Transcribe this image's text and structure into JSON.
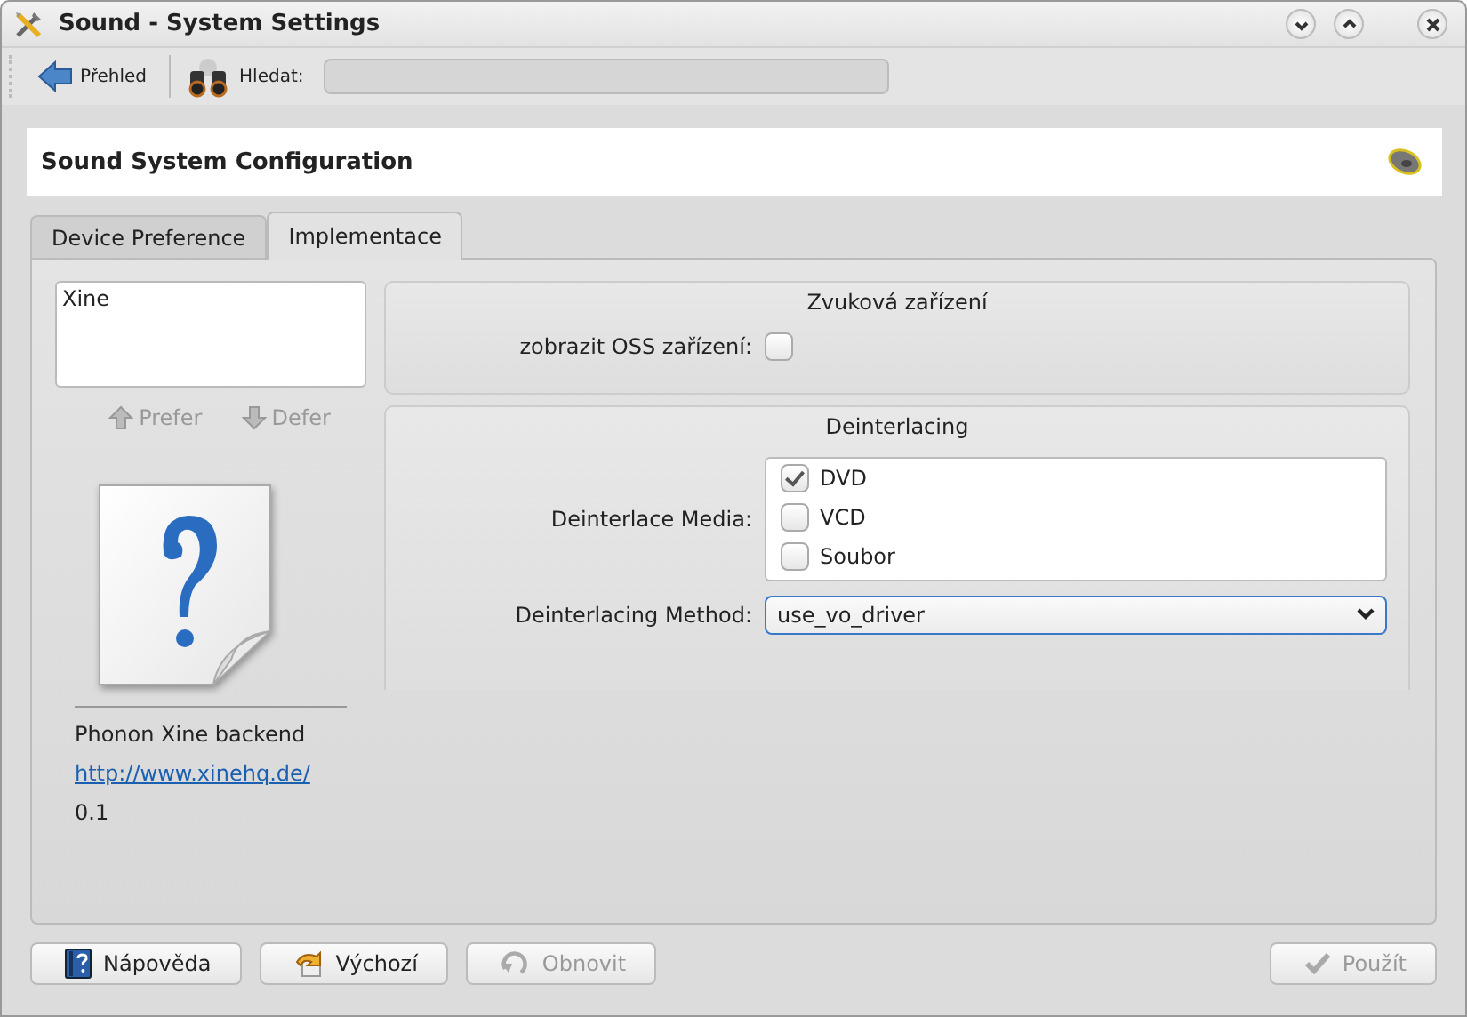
{
  "window": {
    "title": "Sound - System Settings"
  },
  "toolbar": {
    "back_label": "Přehled",
    "search_label": "Hledat:"
  },
  "header": {
    "title": "Sound System Configuration"
  },
  "tabs": [
    {
      "label": "Device Preference",
      "selected": false
    },
    {
      "label": "Implementace",
      "selected": true
    }
  ],
  "backends": [
    {
      "label": "Xine",
      "selected": false
    }
  ],
  "list_buttons": [
    {
      "label": "Prefer",
      "kind": "up",
      "disabled": true
    },
    {
      "label": "Defer",
      "kind": "down",
      "disabled": true
    }
  ],
  "backend_info": {
    "name": "Phonon Xine backend",
    "url": "http://www.xinehq.de/",
    "version": "0.1"
  },
  "groups": [
    {
      "title": "Zvuková zařízení",
      "rows": [
        {
          "kind": "checkbox",
          "label": "zobrazit OSS zařízení:",
          "checked": false
        }
      ]
    },
    {
      "title": "Deinterlacing",
      "rows": [
        {
          "kind": "checklist",
          "label": "Deinterlace Media:",
          "items": [
            {
              "label": "DVD",
              "checked": true
            },
            {
              "label": "VCD",
              "checked": false
            },
            {
              "label": "Soubor",
              "checked": false
            }
          ]
        },
        {
          "kind": "select",
          "label": "Deinterlacing Method:",
          "value": "use_vo_driver"
        }
      ]
    }
  ],
  "buttons": [
    {
      "label": "Nápověda",
      "kind": "help",
      "disabled": false
    },
    {
      "label": "Výchozí",
      "kind": "defaults",
      "disabled": false
    },
    {
      "label": "Obnovit",
      "kind": "reset",
      "disabled": true
    },
    {
      "label": "Použít",
      "kind": "apply",
      "disabled": true
    }
  ]
}
